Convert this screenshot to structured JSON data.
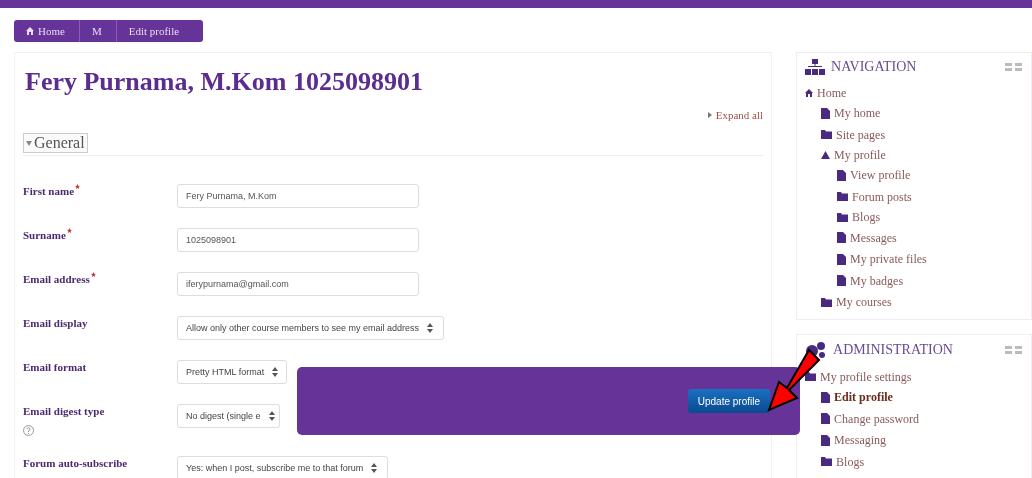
{
  "breadcrumb": [
    {
      "label": "Home",
      "kind": "home"
    },
    {
      "label": "M",
      "kind": "plain"
    },
    {
      "label": "Edit profile",
      "kind": "plain"
    }
  ],
  "heading": "Fery Purnama, M.Kom 1025098901",
  "expand_all": "Expand all",
  "section": {
    "title": "General",
    "expanded": true
  },
  "fields": [
    {
      "label": "First name",
      "required": true,
      "kind": "text",
      "value": "Fery Purnama, M.Kom",
      "help": false
    },
    {
      "label": "Surname",
      "required": true,
      "kind": "text",
      "value": "1025098901",
      "help": false
    },
    {
      "label": "Email address",
      "required": true,
      "kind": "text",
      "value": "iferypurnama@gmail.com",
      "help": false
    },
    {
      "label": "Email display",
      "required": false,
      "kind": "select",
      "value": "Allow only other course members to see my email address",
      "help": false
    },
    {
      "label": "Email format",
      "required": false,
      "kind": "select",
      "value": "Pretty HTML format",
      "help": false
    },
    {
      "label": "Email digest type",
      "required": false,
      "kind": "select",
      "value": "No digest (single e",
      "help": true
    },
    {
      "label": "Forum auto-subscribe",
      "required": false,
      "kind": "select",
      "value": "Yes: when I post, subscribe me to that forum",
      "help": false
    }
  ],
  "save_panel": {
    "button": "Update profile"
  },
  "navigation": {
    "title": "NAVIGATION",
    "items": [
      {
        "label": "Home",
        "kind": "home",
        "children": [
          {
            "label": "My home",
            "kind": "page"
          },
          {
            "label": "Site pages",
            "kind": "folder"
          },
          {
            "label": "My profile",
            "kind": "branch",
            "children": [
              {
                "label": "View profile",
                "kind": "page"
              },
              {
                "label": "Forum posts",
                "kind": "folder"
              },
              {
                "label": "Blogs",
                "kind": "folder"
              },
              {
                "label": "Messages",
                "kind": "page"
              },
              {
                "label": "My private files",
                "kind": "page"
              },
              {
                "label": "My badges",
                "kind": "page"
              }
            ]
          },
          {
            "label": "My courses",
            "kind": "folder"
          }
        ]
      }
    ]
  },
  "administration": {
    "title": "ADMINISTRATION",
    "items": [
      {
        "label": "My profile settings",
        "kind": "folder",
        "selected": false,
        "children": [
          {
            "label": "Edit profile",
            "kind": "page",
            "selected": true
          },
          {
            "label": "Change password",
            "kind": "page",
            "selected": false
          },
          {
            "label": "Messaging",
            "kind": "page",
            "selected": false
          },
          {
            "label": "Blogs",
            "kind": "folder",
            "selected": false
          }
        ]
      }
    ]
  }
}
